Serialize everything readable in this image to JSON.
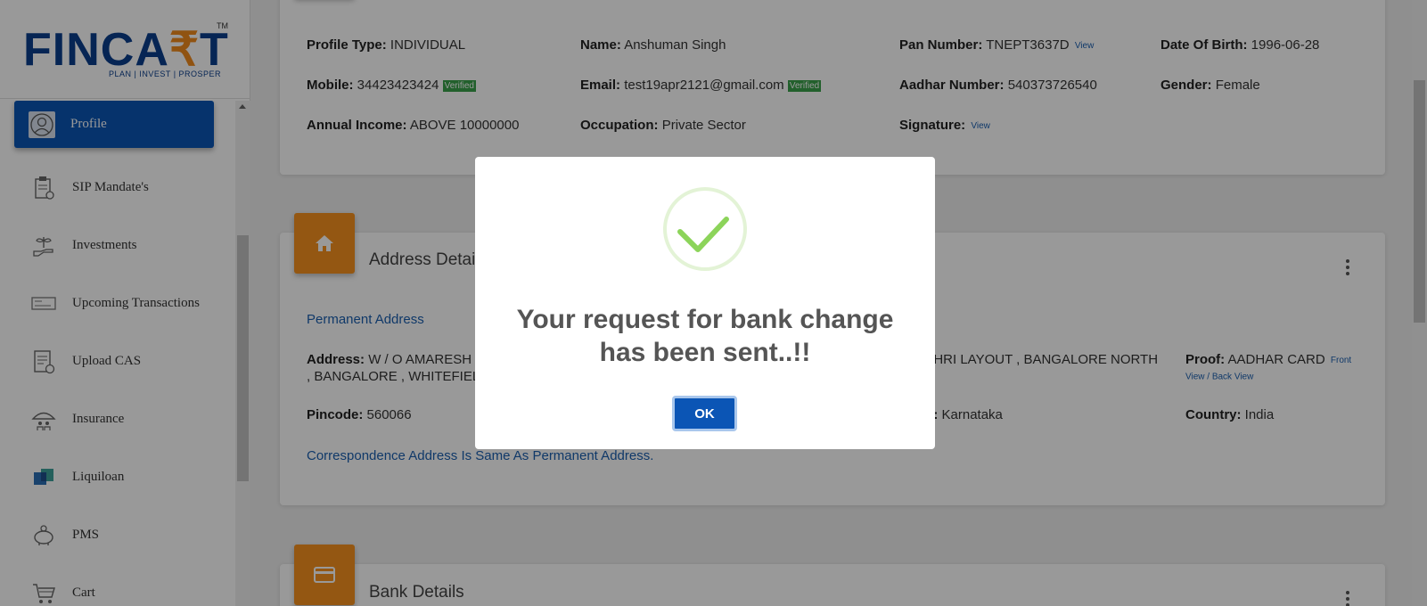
{
  "logo": {
    "text_left": "FINCA",
    "text_rupee": "₹",
    "text_right": "T",
    "tm": "TM",
    "tagline": "PLAN | INVEST | PROSPER"
  },
  "sidebar": {
    "items": [
      {
        "label": "Profile",
        "icon": "user-icon",
        "active": true
      },
      {
        "label": "SIP Mandate's",
        "icon": "clipboard-icon"
      },
      {
        "label": "Investments",
        "icon": "plant-hand-icon"
      },
      {
        "label": "Upcoming Transactions",
        "icon": "cheque-icon"
      },
      {
        "label": "Upload CAS",
        "icon": "document-upload-icon"
      },
      {
        "label": "Insurance",
        "icon": "umbrella-family-icon"
      },
      {
        "label": "Liquiloan",
        "icon": "liquiloan-icon"
      },
      {
        "label": "PMS",
        "icon": "piggy-bank-icon"
      },
      {
        "label": "Cart",
        "icon": "cart-icon"
      }
    ]
  },
  "profile": {
    "profile_type_label": "Profile Type:",
    "profile_type": "INDIVIDUAL",
    "name_label": "Name:",
    "name": "Anshuman Singh",
    "pan_label": "Pan Number:",
    "pan": "TNEPT3637D",
    "pan_view": "View",
    "dob_label": "Date Of Birth:",
    "dob": "1996-06-28",
    "mobile_label": "Mobile:",
    "mobile": "34423423424",
    "mobile_verified": "Verified",
    "email_label": "Email:",
    "email": "test19apr2121@gmail.com",
    "email_verified": "Verified",
    "aadhar_label": "Aadhar Number:",
    "aadhar": "540373726540",
    "gender_label": "Gender:",
    "gender": "Female",
    "income_label": "Annual Income:",
    "income": "ABOVE 10000000",
    "occupation_label": "Occupation:",
    "occupation": "Private Sector",
    "signature_label": "Signature:",
    "signature_view": "View"
  },
  "address": {
    "title": "Address Detai",
    "permanent_label": "Permanent Address",
    "address_label": "Address:",
    "address_line1": "W / O AMARESH M",
    "address_line2": ", BANGALORE , WHITEFIELD",
    "address_mid": "AITHRI LAYOUT , BANGALORE NORTH",
    "proof_label": "Proof:",
    "proof": "AADHAR CARD",
    "proof_front": "Front",
    "proof_view_back": "View / Back View",
    "pincode_label": "Pincode:",
    "pincode": "560066",
    "state_label": "te:",
    "state": "Karnataka",
    "country_label": "Country:",
    "country": "India",
    "correspondence": "Correspondence Address Is Same As Permanent Address."
  },
  "bank": {
    "title": "Bank Details"
  },
  "modal": {
    "message": "Your request for bank change has been sent..!!",
    "ok_label": "OK"
  }
}
